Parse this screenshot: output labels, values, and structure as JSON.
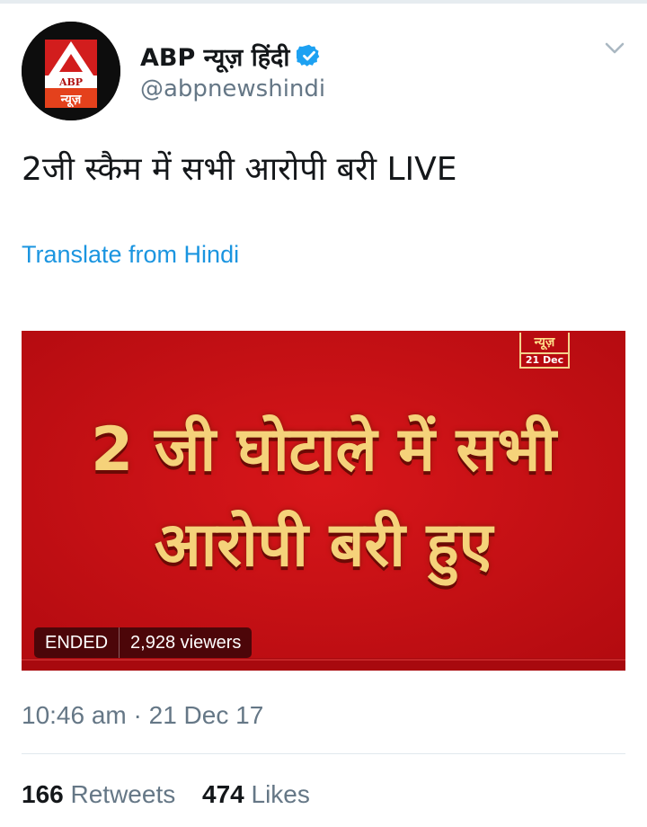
{
  "author": {
    "display_name": "ABP न्यूज़ हिंदी",
    "handle": "@abpnewshindi",
    "avatar_logo_text": "ABP",
    "avatar_sub_text": "न्यूज़"
  },
  "tweet": {
    "text": "2जी स्कैम में सभी आरोपी बरी LIVE",
    "translate_label": "Translate from Hindi",
    "timestamp": "10:46 am · 21 Dec 17"
  },
  "video": {
    "headline_line1": "2 जी घोटाले में सभी",
    "headline_line2": "आरोपी बरी हुए",
    "bug_text": "न्यूज़",
    "bug_date": "21 Dec",
    "status": "ENDED",
    "viewers": "2,928 viewers"
  },
  "stats": {
    "retweets_count": "166",
    "retweets_label": "Retweets",
    "likes_count": "474",
    "likes_label": "Likes"
  },
  "colors": {
    "link": "#1b95e0",
    "secondary_text": "#657786",
    "verified": "#1da1f2",
    "video_bg": "#c90f14"
  },
  "icons": [
    "verified-badge-icon",
    "chevron-down-icon"
  ]
}
